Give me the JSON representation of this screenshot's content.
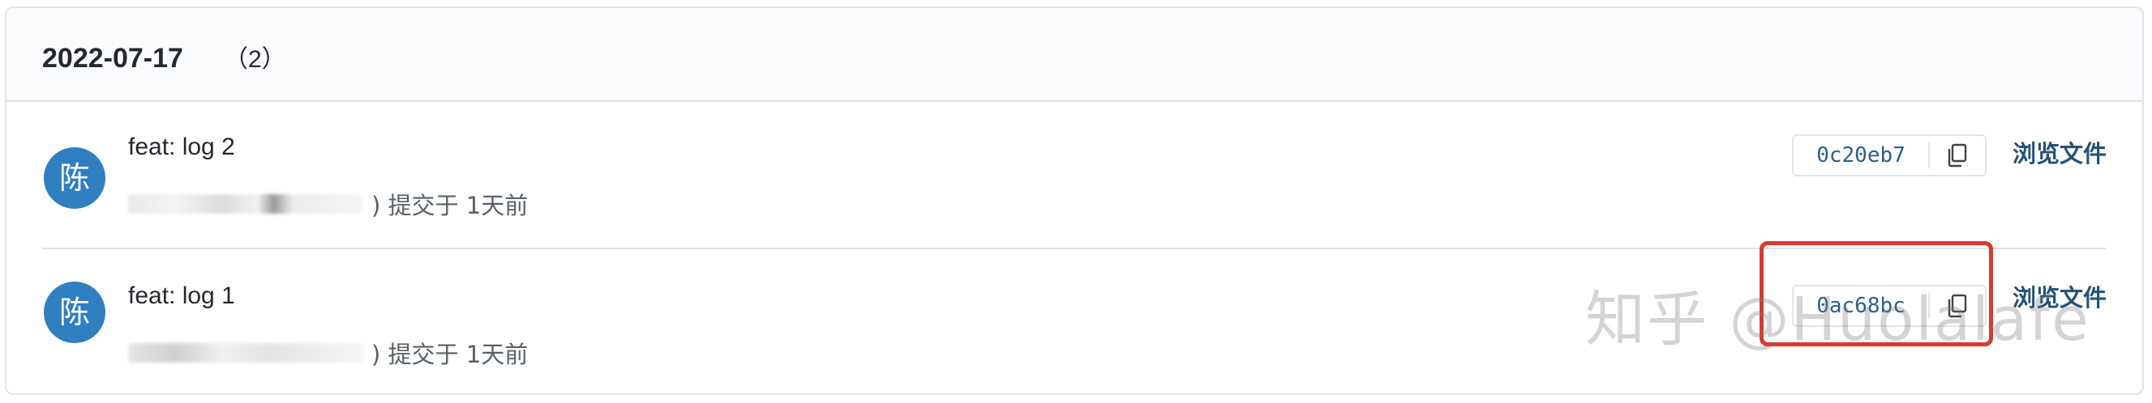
{
  "group": {
    "date": "2022-07-17",
    "count": "（2）"
  },
  "commits": [
    {
      "avatar_char": "陈",
      "message": "feat: log 2",
      "meta_suffix": ") 提交于 1天前",
      "sha": "0c20eb7",
      "browse_label": "浏览文件"
    },
    {
      "avatar_char": "陈",
      "message": "feat: log 1",
      "meta_suffix": ") 提交于 1天前",
      "sha": "0ac68bc",
      "browse_label": "浏览文件"
    }
  ],
  "icons": {
    "copy": "copy-icon"
  },
  "colors": {
    "avatar": "#2f7fc1",
    "link": "#24527a",
    "highlight": "#d93a2b"
  },
  "watermark": "知乎 @Huolalafe"
}
